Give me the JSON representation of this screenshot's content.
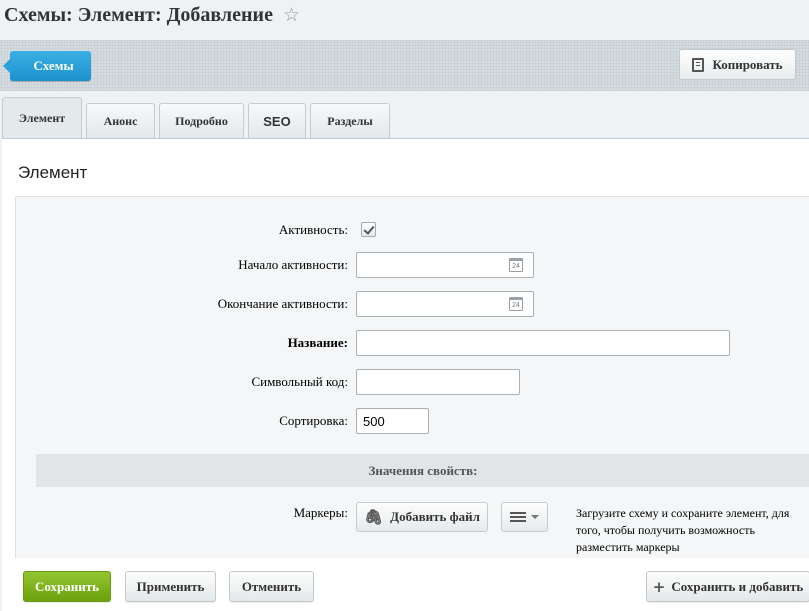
{
  "page": {
    "title": "Схемы: Элемент: Добавление"
  },
  "toolbar": {
    "back_label": "Схемы",
    "copy_label": "Копировать"
  },
  "tabs": [
    {
      "label": "Элемент",
      "active": true
    },
    {
      "label": "Анонс"
    },
    {
      "label": "Подробно"
    },
    {
      "label": "SEO"
    },
    {
      "label": "Разделы"
    }
  ],
  "form": {
    "heading": "Элемент",
    "active_label": "Активность:",
    "active_checked": true,
    "start_label": "Начало активности:",
    "start_value": "",
    "end_label": "Окончание активности:",
    "end_value": "",
    "calendar_day": "24",
    "name_label": "Название:",
    "name_value": "",
    "code_label": "Символьный код:",
    "code_value": "",
    "sort_label": "Сортировка:",
    "sort_value": "500",
    "props_heading": "Значения свойств:",
    "markers_label": "Маркеры:",
    "add_file_label": "Добавить файл",
    "markers_hint": "Загрузите схему и сохраните элемент, для того, чтобы получить возможность разместить маркеры"
  },
  "footer": {
    "save_label": "Сохранить",
    "apply_label": "Применить",
    "cancel_label": "Отменить",
    "save_add_label": "Сохранить и добавить"
  },
  "colors": {
    "accent_blue": "#1c90cc",
    "save_green": "#7ab21c"
  }
}
